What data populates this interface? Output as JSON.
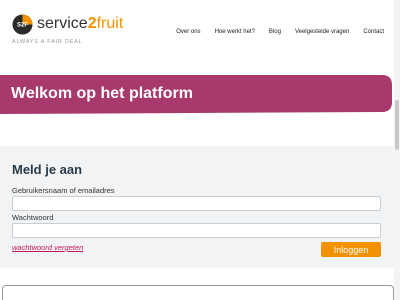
{
  "brand": {
    "logo_mark_text": "S2F",
    "name_part1": "service",
    "name_part2": "2",
    "name_part3": "fruit",
    "tagline": "ALWAYS A FAIR DEAL"
  },
  "nav": {
    "items": [
      {
        "label": "Over ons"
      },
      {
        "label": "Hoe werkt het?"
      },
      {
        "label": "Blog"
      },
      {
        "label": "Veelgestelde vragen"
      },
      {
        "label": "Contact"
      }
    ]
  },
  "banner": {
    "title": "Welkom op het platform"
  },
  "login": {
    "title": "Meld je aan",
    "username_label": "Gebruikersnaam of emailadres",
    "username_value": "",
    "password_label": "Wachtwoord",
    "password_value": "",
    "forgot_label": "wachtwoord vergeten",
    "submit_label": "Inloggen"
  },
  "colors": {
    "brand_orange": "#f39200",
    "banner_magenta": "#a8396c",
    "link_pink": "#c2185b",
    "panel_bg": "#f1f3f5"
  }
}
